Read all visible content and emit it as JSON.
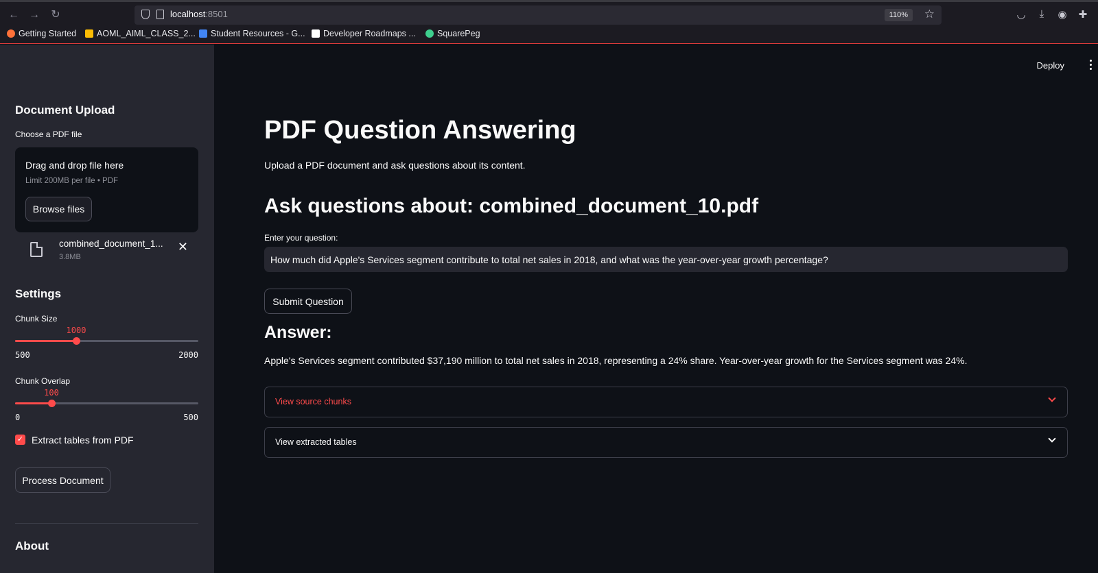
{
  "browser": {
    "url_host": "localhost",
    "url_port": ":8501",
    "zoom": "110%",
    "bookmarks": [
      {
        "label": "Getting Started",
        "color": "#ff7139"
      },
      {
        "label": "AOML_AIML_CLASS_2...",
        "color": "#fbbc04"
      },
      {
        "label": "Student Resources - G...",
        "color": "#4285f4"
      },
      {
        "label": "Developer Roadmaps ...",
        "color": "#ffffff"
      },
      {
        "label": "SquarePeg",
        "color": "#3ecf8e"
      }
    ]
  },
  "sidebar": {
    "upload_heading": "Document Upload",
    "choose_label": "Choose a PDF file",
    "dropzone_title": "Drag and drop file here",
    "dropzone_limit": "Limit 200MB per file • PDF",
    "browse_label": "Browse files",
    "file_name": "combined_document_1...",
    "file_size": "3.8MB",
    "settings_heading": "Settings",
    "chunk_size": {
      "label": "Chunk Size",
      "value": "1000",
      "min": "500",
      "max": "2000"
    },
    "chunk_overlap": {
      "label": "Chunk Overlap",
      "value": "100",
      "min": "0",
      "max": "500"
    },
    "extract_tables_label": "Extract tables from PDF",
    "extract_tables_checked": true,
    "process_label": "Process Document",
    "about_heading": "About"
  },
  "main": {
    "deploy_label": "Deploy",
    "title": "PDF Question Answering",
    "subtitle": "Upload a PDF document and ask questions about its content.",
    "ask_heading": "Ask questions about: combined_document_10.pdf",
    "question_label": "Enter your question:",
    "question_value": "How much did Apple's Services segment contribute to total net sales in 2018, and what was the year-over-year growth percentage?",
    "submit_label": "Submit Question",
    "answer_heading": "Answer:",
    "answer_text": "Apple's Services segment contributed $37,190 million to total net sales in 2018, representing a 24% share. Year-over-year growth for the Services segment was 24%.",
    "expanders": [
      {
        "label": "View source chunks",
        "color": "#ff4b4b"
      },
      {
        "label": "View extracted tables",
        "color": "#fafafa"
      }
    ]
  },
  "colors": {
    "accent": "#ff4b4b",
    "sidebar_bg": "#262730",
    "main_bg": "#0e1117"
  }
}
